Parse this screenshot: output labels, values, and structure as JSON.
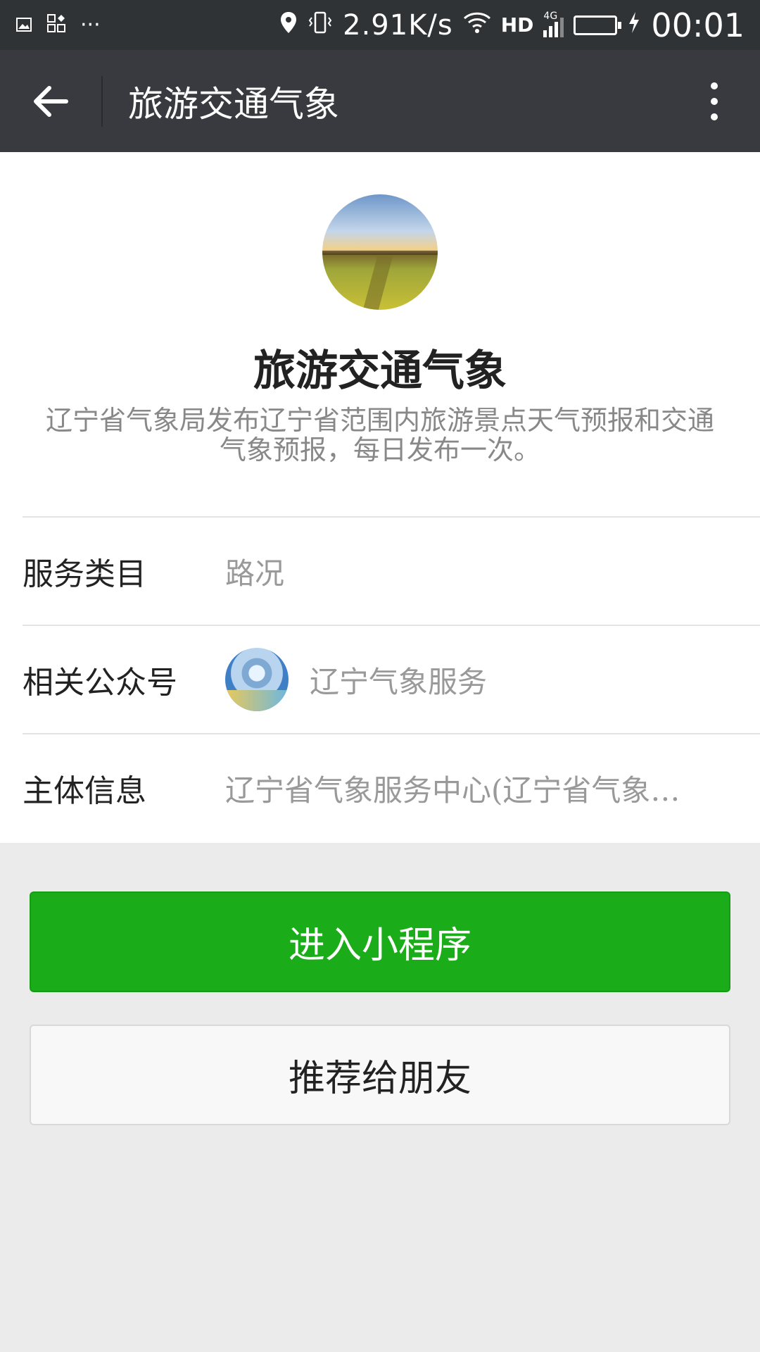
{
  "status_bar": {
    "speed": "2.91K/s",
    "network": "HD",
    "signal": "4G",
    "time": "00:01"
  },
  "nav": {
    "title": "旅游交通气象"
  },
  "profile": {
    "name": "旅游交通气象",
    "description": "辽宁省气象局发布辽宁省范围内旅游景点天气预报和交通气象预报，每日发布一次。"
  },
  "rows": {
    "service_category": {
      "label": "服务类目",
      "value": "路况"
    },
    "related_account": {
      "label": "相关公众号",
      "value": "辽宁气象服务"
    },
    "entity_info": {
      "label": "主体信息",
      "value": "辽宁省气象服务中心(辽宁省气象…"
    }
  },
  "buttons": {
    "enter_miniprogram": "进入小程序",
    "recommend": "推荐给朋友"
  },
  "colors": {
    "nav_bg": "#393a3f",
    "status_bg": "#303336",
    "primary_green": "#1aad19",
    "page_bg": "#ebebeb"
  }
}
